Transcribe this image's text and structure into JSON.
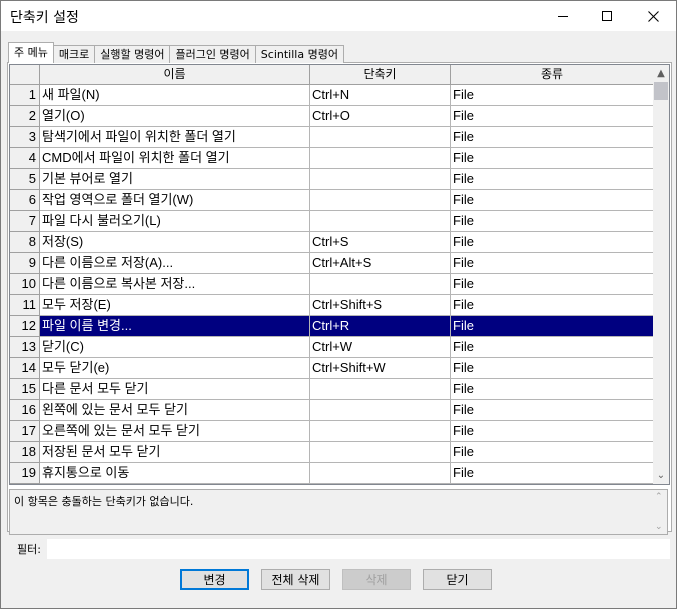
{
  "window": {
    "title": "단축키 설정"
  },
  "tabs": [
    {
      "label": "주 메뉴"
    },
    {
      "label": "매크로"
    },
    {
      "label": "실행할 명령어"
    },
    {
      "label": "플러그인 명령어"
    },
    {
      "label": "Scintilla 명령어"
    }
  ],
  "grid": {
    "headers": {
      "name": "이름",
      "shortcut": "단축키",
      "category": "종류"
    },
    "selected_row": 12,
    "rows": [
      {
        "num": "1",
        "name": "새 파일(N)",
        "shortcut": "Ctrl+N",
        "category": "File"
      },
      {
        "num": "2",
        "name": "열기(O)",
        "shortcut": "Ctrl+O",
        "category": "File"
      },
      {
        "num": "3",
        "name": "탐색기에서 파일이 위치한 폴더 열기",
        "shortcut": "",
        "category": "File"
      },
      {
        "num": "4",
        "name": "CMD에서 파일이 위치한 폴더 열기",
        "shortcut": "",
        "category": "File"
      },
      {
        "num": "5",
        "name": "기본 뷰어로 열기",
        "shortcut": "",
        "category": "File"
      },
      {
        "num": "6",
        "name": "작업 영역으로 폴더 열기(W)",
        "shortcut": "",
        "category": "File"
      },
      {
        "num": "7",
        "name": "파일 다시 불러오기(L)",
        "shortcut": "",
        "category": "File"
      },
      {
        "num": "8",
        "name": "저장(S)",
        "shortcut": "Ctrl+S",
        "category": "File"
      },
      {
        "num": "9",
        "name": "다른 이름으로 저장(A)...",
        "shortcut": "Ctrl+Alt+S",
        "category": "File"
      },
      {
        "num": "10",
        "name": "다른 이름으로 복사본 저장...",
        "shortcut": "",
        "category": "File"
      },
      {
        "num": "11",
        "name": "모두 저장(E)",
        "shortcut": "Ctrl+Shift+S",
        "category": "File"
      },
      {
        "num": "12",
        "name": "파일 이름 변경...",
        "shortcut": "Ctrl+R",
        "category": "File"
      },
      {
        "num": "13",
        "name": "닫기(C)",
        "shortcut": "Ctrl+W",
        "category": "File"
      },
      {
        "num": "14",
        "name": "모두 닫기(e)",
        "shortcut": "Ctrl+Shift+W",
        "category": "File"
      },
      {
        "num": "15",
        "name": "다른 문서 모두 닫기",
        "shortcut": "",
        "category": "File"
      },
      {
        "num": "16",
        "name": "왼쪽에 있는 문서 모두 닫기",
        "shortcut": "",
        "category": "File"
      },
      {
        "num": "17",
        "name": "오른쪽에 있는 문서 모두 닫기",
        "shortcut": "",
        "category": "File"
      },
      {
        "num": "18",
        "name": "저장된 문서 모두 닫기",
        "shortcut": "",
        "category": "File"
      },
      {
        "num": "19",
        "name": "휴지통으로 이동",
        "shortcut": "",
        "category": "File"
      }
    ]
  },
  "info": {
    "text": "이 항목은 충돌하는 단축키가 없습니다."
  },
  "filter": {
    "label": "필터:",
    "value": ""
  },
  "buttons": {
    "change": "변경",
    "clear_all": "전체 삭제",
    "delete": "삭제",
    "close": "닫기"
  }
}
